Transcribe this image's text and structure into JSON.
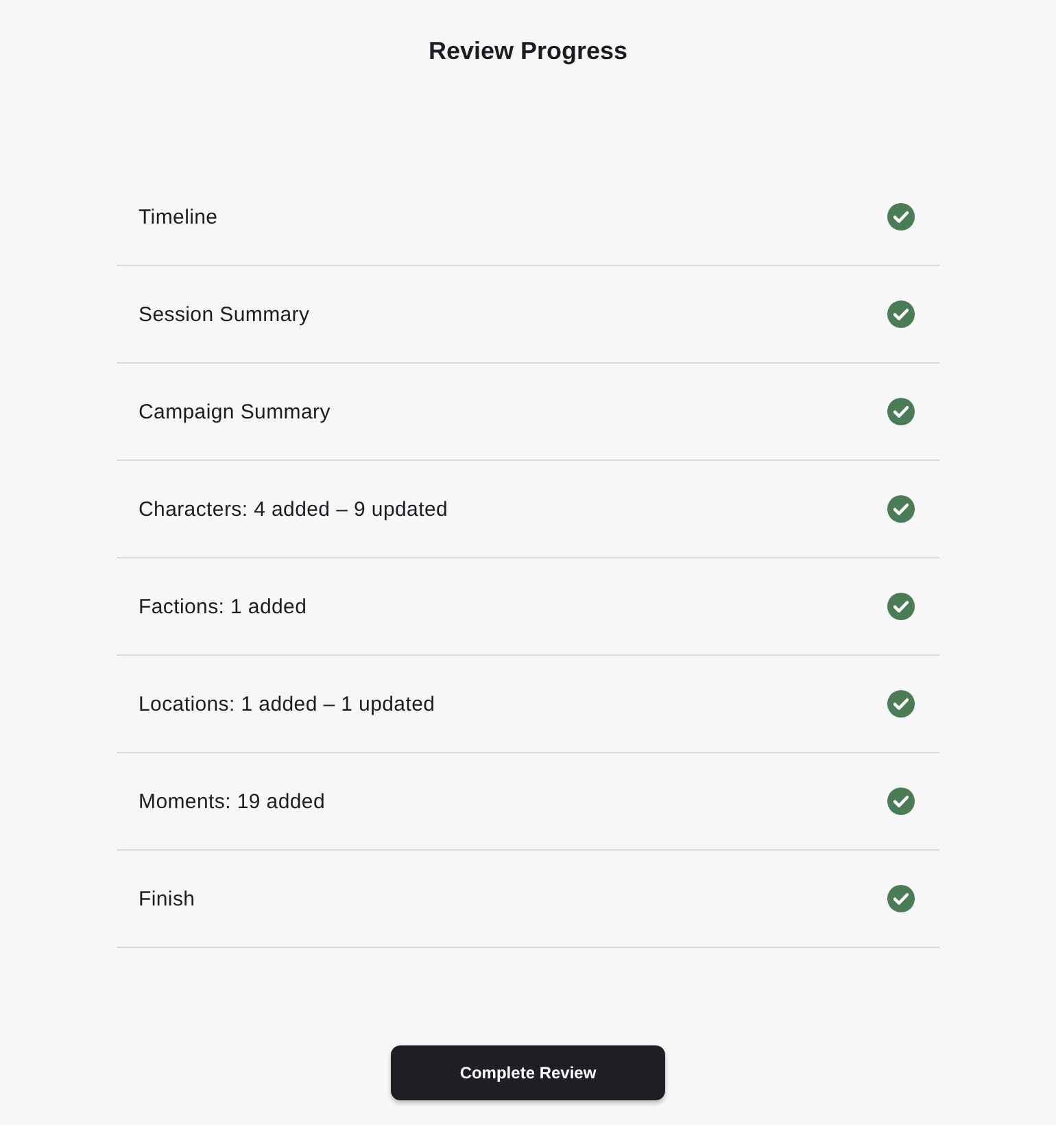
{
  "title": "Review Progress",
  "steps": [
    {
      "label": "Timeline",
      "done": true
    },
    {
      "label": "Session Summary",
      "done": true
    },
    {
      "label": "Campaign Summary",
      "done": true
    },
    {
      "label": "Characters: 4 added – 9 updated",
      "done": true
    },
    {
      "label": "Factions: 1 added",
      "done": true
    },
    {
      "label": "Locations: 1 added – 1 updated",
      "done": true
    },
    {
      "label": "Moments: 19 added",
      "done": true
    },
    {
      "label": "Finish",
      "done": true
    }
  ],
  "button": "Complete Review"
}
